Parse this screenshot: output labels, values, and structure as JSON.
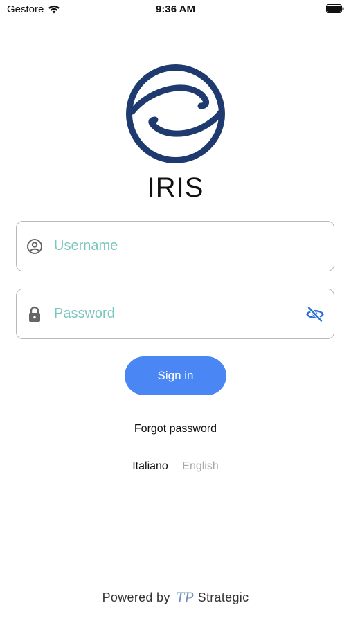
{
  "status_bar": {
    "carrier": "Gestore",
    "time": "9:36 AM"
  },
  "app": {
    "title": "IRIS",
    "logo_icon": "iris-eye-logo-icon",
    "brand_color": "#1e3a6e"
  },
  "form": {
    "username_placeholder": "Username",
    "username_value": "",
    "password_placeholder": "Password",
    "password_value": "",
    "sign_in_label": "Sign in",
    "forgot_password_label": "Forgot password"
  },
  "languages": {
    "italian": "Italiano",
    "english": "English"
  },
  "footer": {
    "powered_by": "Powered by",
    "company": "Strategic",
    "company_mark": "TP"
  },
  "colors": {
    "accent": "#4a87f5",
    "placeholder": "#7cc6c0",
    "eye_icon": "#2a6fd6",
    "inactive_text": "#a8a8a8"
  }
}
